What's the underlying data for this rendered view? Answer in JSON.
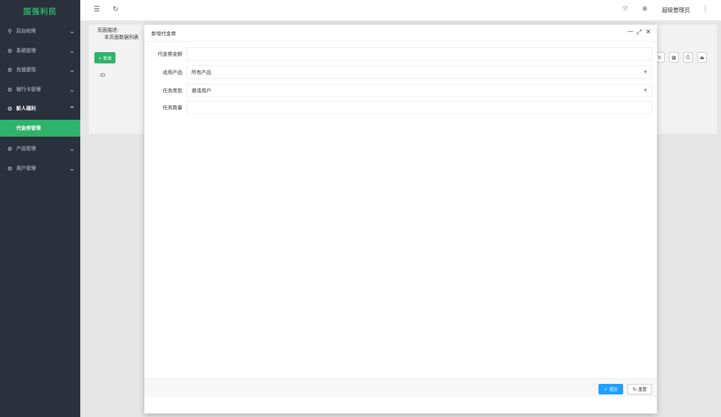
{
  "sidebar": {
    "logo": "国强利民",
    "items": [
      {
        "label": "后台权限",
        "icon": "user-icon",
        "glyph": "⚲"
      },
      {
        "label": "系统管理",
        "icon": "gear-icon",
        "glyph": "⚙"
      },
      {
        "label": "充值提现",
        "icon": "gear-icon",
        "glyph": "⚙"
      },
      {
        "label": "银行卡管理",
        "icon": "gear-icon",
        "glyph": "⚙"
      },
      {
        "label": "新人福利",
        "icon": "gear-icon",
        "glyph": "⚙"
      },
      {
        "label": "产品管理",
        "icon": "gear-icon",
        "glyph": "⚙"
      },
      {
        "label": "用户管理",
        "icon": "gear-icon",
        "glyph": "⚙"
      }
    ],
    "active_submenu": "代金券管理",
    "accent_color": "#2fb26b"
  },
  "header": {
    "admin_name": "超级管理员"
  },
  "page": {
    "desc_label": "页面描述:",
    "desc_text": "本页面数据列表",
    "add_button": "+ 新增",
    "column_id": "ID"
  },
  "modal": {
    "title": "新增代金券",
    "fields": [
      {
        "label": "代金券金额",
        "value": "",
        "type": "input"
      },
      {
        "label": "适用产品",
        "value": "所有产品",
        "type": "select"
      },
      {
        "label": "任务类型",
        "value": "邀请用户",
        "type": "select"
      },
      {
        "label": "任务数量",
        "value": "",
        "type": "input"
      }
    ],
    "submit_label": "提交",
    "reset_label": "重置",
    "submit_color": "#1e9fff"
  }
}
